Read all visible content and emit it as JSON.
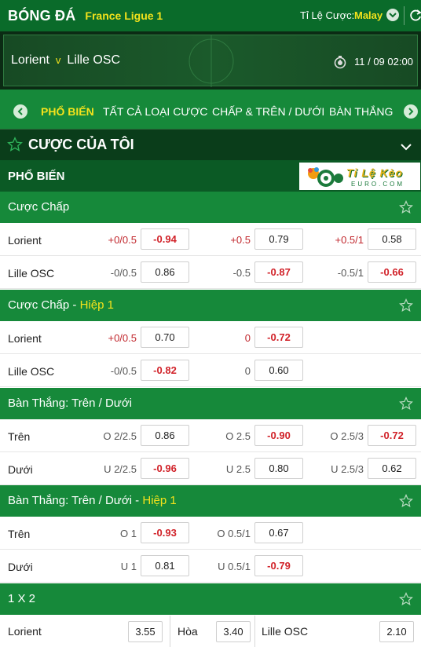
{
  "header": {
    "title": "BÓNG ĐÁ",
    "league": "France Ligue 1",
    "odds_type_label": "Tỉ Lệ Cược:",
    "odds_type_value": "Malay"
  },
  "match": {
    "home": "Lorient",
    "vs": "v",
    "away": "Lille OSC",
    "kickoff": "11 / 09  02:00"
  },
  "tabs": [
    "PHỔ BIẾN",
    "TẤT CẢ LOẠI CƯỢC",
    "CHẤP & TRÊN / DƯỚI",
    "BÀN THẮNG"
  ],
  "my_bets": {
    "label": "CƯỢC CỦA TÔI"
  },
  "popular": {
    "label": "PHỔ BIẾN"
  },
  "logo": {
    "brand": "Tỉ Lệ Kèo",
    "url": "EURO.COM"
  },
  "sections": {
    "handicap": {
      "title": "Cược Chấp",
      "rows": [
        {
          "name": "Lorient",
          "cells": [
            {
              "line": "+0/0.5",
              "line_red": true,
              "odds": "-0.94",
              "neg": true
            },
            {
              "line": "+0.5",
              "line_red": true,
              "odds": "0.79",
              "neg": false
            },
            {
              "line": "+0.5/1",
              "line_red": true,
              "odds": "0.58",
              "neg": false
            }
          ]
        },
        {
          "name": "Lille OSC",
          "cells": [
            {
              "line": "-0/0.5",
              "line_red": false,
              "odds": "0.86",
              "neg": false
            },
            {
              "line": "-0.5",
              "line_red": false,
              "odds": "-0.87",
              "neg": true
            },
            {
              "line": "-0.5/1",
              "line_red": false,
              "odds": "-0.66",
              "neg": true
            }
          ]
        }
      ]
    },
    "handicap_h1": {
      "title": "Cược Chấp",
      "sep": " - ",
      "suffix": "Hiệp 1",
      "rows": [
        {
          "name": "Lorient",
          "cells": [
            {
              "line": "+0/0.5",
              "line_red": true,
              "odds": "0.70",
              "neg": false
            },
            {
              "line": "0",
              "line_red": true,
              "odds": "-0.72",
              "neg": true
            }
          ]
        },
        {
          "name": "Lille OSC",
          "cells": [
            {
              "line": "-0/0.5",
              "line_red": false,
              "odds": "-0.82",
              "neg": true
            },
            {
              "line": "0",
              "line_red": false,
              "odds": "0.60",
              "neg": false
            }
          ]
        }
      ]
    },
    "ou": {
      "title": "Bàn Thắng: Trên / Dưới",
      "rows": [
        {
          "name": "Trên",
          "cells": [
            {
              "line": "O  2/2.5",
              "line_red": false,
              "odds": "0.86",
              "neg": false
            },
            {
              "line": "O  2.5",
              "line_red": false,
              "odds": "-0.90",
              "neg": true
            },
            {
              "line": "O  2.5/3",
              "line_red": false,
              "odds": "-0.72",
              "neg": true
            }
          ]
        },
        {
          "name": "Dưới",
          "cells": [
            {
              "line": "U  2/2.5",
              "line_red": false,
              "odds": "-0.96",
              "neg": true
            },
            {
              "line": "U  2.5",
              "line_red": false,
              "odds": "0.80",
              "neg": false
            },
            {
              "line": "U  2.5/3",
              "line_red": false,
              "odds": "0.62",
              "neg": false
            }
          ]
        }
      ]
    },
    "ou_h1": {
      "title": "Bàn Thắng: Trên / Dưới",
      "sep": " - ",
      "suffix": "Hiệp 1",
      "rows": [
        {
          "name": "Trên",
          "cells": [
            {
              "line": "O  1",
              "line_red": false,
              "odds": "-0.93",
              "neg": true
            },
            {
              "line": "O  0.5/1",
              "line_red": false,
              "odds": "0.67",
              "neg": false
            }
          ]
        },
        {
          "name": "Dưới",
          "cells": [
            {
              "line": "U  1",
              "line_red": false,
              "odds": "0.81",
              "neg": false
            },
            {
              "line": "U  0.5/1",
              "line_red": false,
              "odds": "-0.79",
              "neg": true
            }
          ]
        }
      ]
    },
    "x12": {
      "title": "1 X 2",
      "home_label": "Lorient",
      "home_odds": "3.55",
      "draw_label": "Hòa",
      "draw_odds": "3.40",
      "away_label": "Lille OSC",
      "away_odds": "2.10"
    }
  },
  "colors": {
    "green": "#16893a",
    "dark_green": "#0a6b2a",
    "yellow": "#f3e21c",
    "red": "#d12229"
  }
}
